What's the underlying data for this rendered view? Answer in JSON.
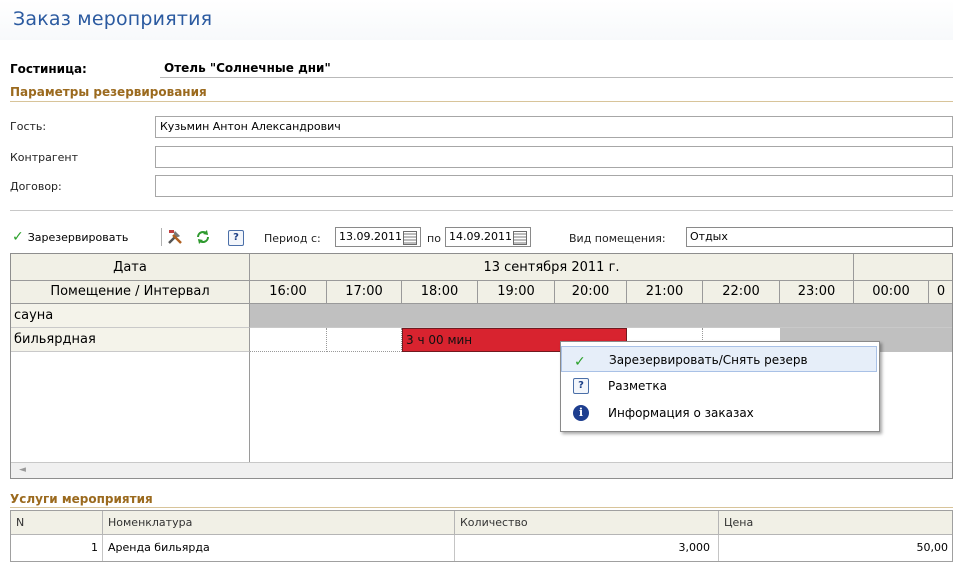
{
  "window": {
    "title": "Заказ мероприятия"
  },
  "hotel": {
    "label": "Гостиница:",
    "value": "Отель \"Солнечные дни\""
  },
  "reservation_params": {
    "heading": "Параметры резервирования",
    "guest_label": "Гость:",
    "guest_value": "Кузьмин Антон Александрович",
    "counterparty_label": "Контрагент",
    "counterparty_value": "",
    "contract_label": "Договор:",
    "contract_value": ""
  },
  "toolbar": {
    "reserve_label": "Зарезервировать",
    "period_from_label": "Период с:",
    "period_from_value": "13.09.2011",
    "period_to_label": "по",
    "period_to_value": "14.09.2011",
    "room_type_label": "Вид помещения:",
    "room_type_value": "Отдых"
  },
  "schedule": {
    "date_header": "Дата",
    "room_interval_header": "Помещение / Интервал",
    "day_header": "13 сентября 2011 г.",
    "hours": [
      "16:00",
      "17:00",
      "18:00",
      "19:00",
      "20:00",
      "21:00",
      "22:00",
      "23:00",
      "00:00",
      "0"
    ],
    "rows": [
      {
        "name": "сауна"
      },
      {
        "name": "бильярдная"
      }
    ],
    "reservation_label": "3 ч 00 мин",
    "reservation_color": "#d8232f"
  },
  "context_menu": {
    "items": [
      {
        "label": "Зарезервировать/Снять резерв",
        "icon": "check-icon"
      },
      {
        "label": "Разметка",
        "icon": "help-icon"
      },
      {
        "label": "Информация о заказах",
        "icon": "info-icon"
      }
    ]
  },
  "services": {
    "heading": "Услуги мероприятия",
    "columns": [
      "N",
      "Номенклатура",
      "Количество",
      "Цена"
    ],
    "rows": [
      {
        "n": "1",
        "item": "Аренда бильярда",
        "qty": "3,000",
        "price": "50,00"
      }
    ]
  },
  "colors": {
    "title": "#2b5aa0",
    "section": "#9b6a1e",
    "booked_gray": "#c0c0c0"
  }
}
